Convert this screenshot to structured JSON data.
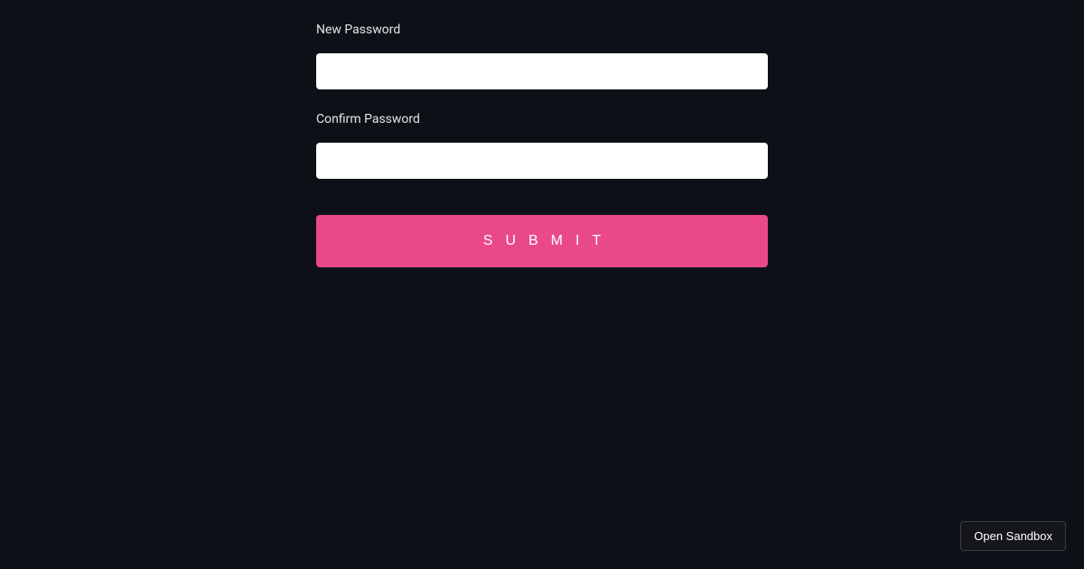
{
  "form": {
    "new_password_label": "New Password",
    "new_password_value": "",
    "confirm_password_label": "Confirm Password",
    "confirm_password_value": "",
    "submit_label": "SUBMIT"
  },
  "sandbox": {
    "open_label": "Open Sandbox"
  }
}
